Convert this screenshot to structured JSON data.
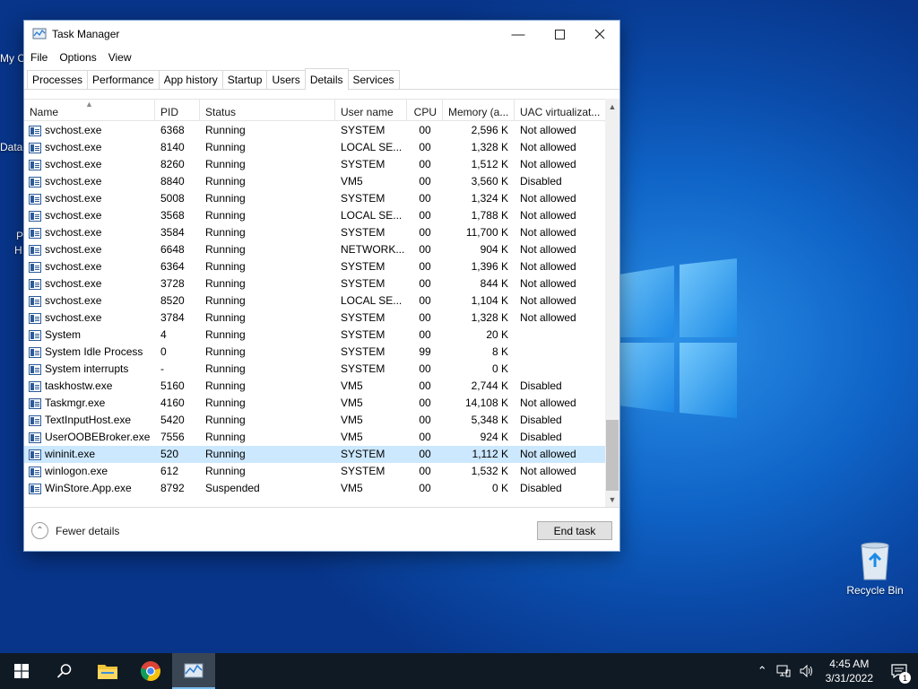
{
  "desktop": {
    "edge_labels": [
      "My C",
      "Data",
      "P",
      "H"
    ],
    "recycle_bin_label": "Recycle Bin"
  },
  "window": {
    "title": "Task Manager",
    "menu": [
      "File",
      "Options",
      "View"
    ],
    "tabs": [
      "Processes",
      "Performance",
      "App history",
      "Startup",
      "Users",
      "Details",
      "Services"
    ],
    "active_tab": "Details",
    "columns": [
      "Name",
      "PID",
      "Status",
      "User name",
      "CPU",
      "Memory (a...",
      "UAC virtualizat..."
    ],
    "rows": [
      {
        "name": "svchost.exe",
        "pid": "6368",
        "status": "Running",
        "user": "SYSTEM",
        "cpu": "00",
        "mem": "2,596 K",
        "uac": "Not allowed"
      },
      {
        "name": "svchost.exe",
        "pid": "8140",
        "status": "Running",
        "user": "LOCAL SE...",
        "cpu": "00",
        "mem": "1,328 K",
        "uac": "Not allowed"
      },
      {
        "name": "svchost.exe",
        "pid": "8260",
        "status": "Running",
        "user": "SYSTEM",
        "cpu": "00",
        "mem": "1,512 K",
        "uac": "Not allowed"
      },
      {
        "name": "svchost.exe",
        "pid": "8840",
        "status": "Running",
        "user": "VM5",
        "cpu": "00",
        "mem": "3,560 K",
        "uac": "Disabled"
      },
      {
        "name": "svchost.exe",
        "pid": "5008",
        "status": "Running",
        "user": "SYSTEM",
        "cpu": "00",
        "mem": "1,324 K",
        "uac": "Not allowed"
      },
      {
        "name": "svchost.exe",
        "pid": "3568",
        "status": "Running",
        "user": "LOCAL SE...",
        "cpu": "00",
        "mem": "1,788 K",
        "uac": "Not allowed"
      },
      {
        "name": "svchost.exe",
        "pid": "3584",
        "status": "Running",
        "user": "SYSTEM",
        "cpu": "00",
        "mem": "11,700 K",
        "uac": "Not allowed"
      },
      {
        "name": "svchost.exe",
        "pid": "6648",
        "status": "Running",
        "user": "NETWORK...",
        "cpu": "00",
        "mem": "904 K",
        "uac": "Not allowed"
      },
      {
        "name": "svchost.exe",
        "pid": "6364",
        "status": "Running",
        "user": "SYSTEM",
        "cpu": "00",
        "mem": "1,396 K",
        "uac": "Not allowed"
      },
      {
        "name": "svchost.exe",
        "pid": "3728",
        "status": "Running",
        "user": "SYSTEM",
        "cpu": "00",
        "mem": "844 K",
        "uac": "Not allowed"
      },
      {
        "name": "svchost.exe",
        "pid": "8520",
        "status": "Running",
        "user": "LOCAL SE...",
        "cpu": "00",
        "mem": "1,104 K",
        "uac": "Not allowed"
      },
      {
        "name": "svchost.exe",
        "pid": "3784",
        "status": "Running",
        "user": "SYSTEM",
        "cpu": "00",
        "mem": "1,328 K",
        "uac": "Not allowed"
      },
      {
        "name": "System",
        "pid": "4",
        "status": "Running",
        "user": "SYSTEM",
        "cpu": "00",
        "mem": "20 K",
        "uac": ""
      },
      {
        "name": "System Idle Process",
        "pid": "0",
        "status": "Running",
        "user": "SYSTEM",
        "cpu": "99",
        "mem": "8 K",
        "uac": ""
      },
      {
        "name": "System interrupts",
        "pid": "-",
        "status": "Running",
        "user": "SYSTEM",
        "cpu": "00",
        "mem": "0 K",
        "uac": ""
      },
      {
        "name": "taskhostw.exe",
        "pid": "5160",
        "status": "Running",
        "user": "VM5",
        "cpu": "00",
        "mem": "2,744 K",
        "uac": "Disabled"
      },
      {
        "name": "Taskmgr.exe",
        "pid": "4160",
        "status": "Running",
        "user": "VM5",
        "cpu": "00",
        "mem": "14,108 K",
        "uac": "Not allowed"
      },
      {
        "name": "TextInputHost.exe",
        "pid": "5420",
        "status": "Running",
        "user": "VM5",
        "cpu": "00",
        "mem": "5,348 K",
        "uac": "Disabled"
      },
      {
        "name": "UserOOBEBroker.exe",
        "pid": "7556",
        "status": "Running",
        "user": "VM5",
        "cpu": "00",
        "mem": "924 K",
        "uac": "Disabled"
      },
      {
        "name": "wininit.exe",
        "pid": "520",
        "status": "Running",
        "user": "SYSTEM",
        "cpu": "00",
        "mem": "1,112 K",
        "uac": "Not allowed"
      },
      {
        "name": "winlogon.exe",
        "pid": "612",
        "status": "Running",
        "user": "SYSTEM",
        "cpu": "00",
        "mem": "1,532 K",
        "uac": "Not allowed"
      },
      {
        "name": "WinStore.App.exe",
        "pid": "8792",
        "status": "Suspended",
        "user": "VM5",
        "cpu": "00",
        "mem": "0 K",
        "uac": "Disabled"
      }
    ],
    "selected_row": "wininit.exe",
    "footer": {
      "fewer_details": "Fewer details",
      "end_task": "End task"
    }
  },
  "taskbar": {
    "apps": [
      "start-icon",
      "search-icon",
      "file-explorer-icon",
      "chrome-icon",
      "task-manager-icon"
    ],
    "active_app": "task-manager-icon",
    "time": "4:45 AM",
    "date": "3/31/2022",
    "notification_count": "1"
  },
  "colors": {
    "selection": "#cce8ff",
    "taskbar": "#101a24",
    "accent": "#76b9ed"
  }
}
